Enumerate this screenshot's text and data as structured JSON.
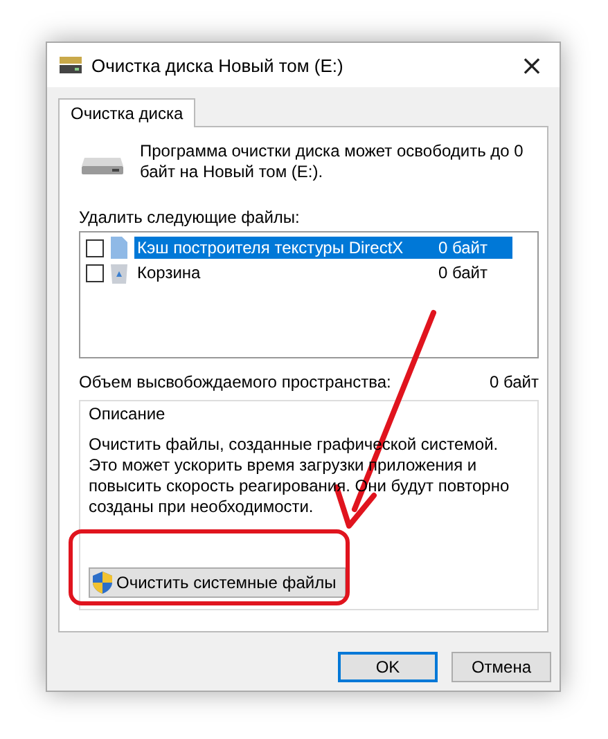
{
  "window": {
    "title": "Очистка диска Новый том (E:)",
    "close": "×"
  },
  "tabs": [
    {
      "label": "Очистка диска",
      "selected": true
    }
  ],
  "intro": "Программа очистки диска может освободить до 0 байт на Новый том (E:).",
  "files_label": "Удалить следующие файлы:",
  "files": [
    {
      "name": "Кэш построителя текстуры DirectX",
      "size": "0 байт",
      "checked": false,
      "selected": true,
      "kind": "file"
    },
    {
      "name": "Корзина",
      "size": "0 байт",
      "checked": false,
      "selected": false,
      "kind": "recycle"
    }
  ],
  "space_label": "Объем высвобождаемого пространства:",
  "space_value": "0 байт",
  "description": {
    "title": "Описание",
    "text": "Очистить файлы, созданные графической системой. Это может ускорить время загрузки приложения и повысить скорость реагирования. Они будут повторно созданы при необходимости."
  },
  "system_button": "Очистить системные файлы",
  "buttons": [
    {
      "label": "OK",
      "default": true
    },
    {
      "label": "Отмена",
      "default": false
    }
  ]
}
